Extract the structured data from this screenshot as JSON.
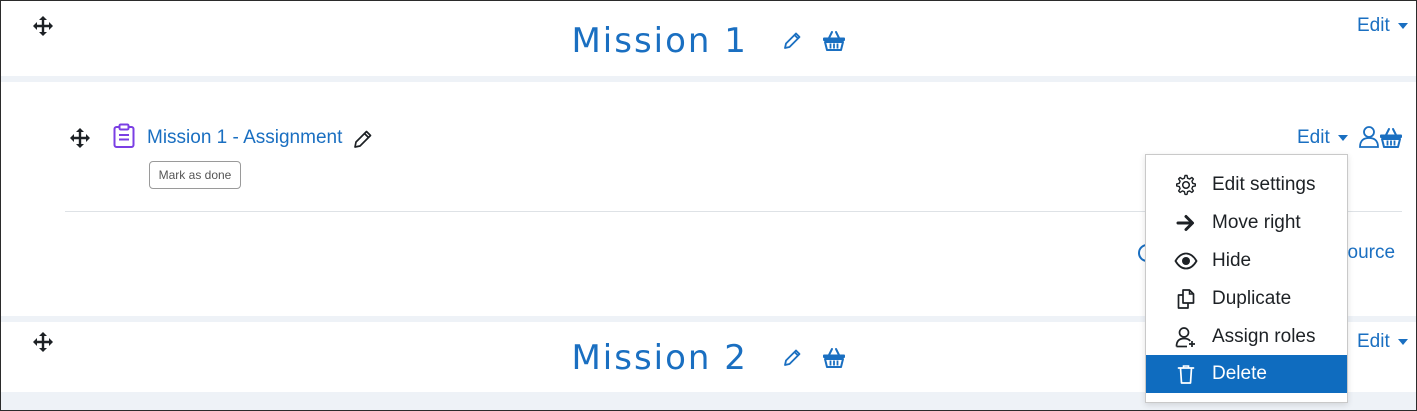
{
  "section1": {
    "title": "Mission 1",
    "edit_label": "Edit"
  },
  "activity": {
    "name": "Mission 1 - Assignment",
    "mark_done_label": "Mark as done",
    "edit_label": "Edit",
    "add_resource_label_visible": "source"
  },
  "menu": {
    "items": [
      {
        "label": "Edit settings",
        "icon": "gear-icon"
      },
      {
        "label": "Move right",
        "icon": "arrow-right-icon"
      },
      {
        "label": "Hide",
        "icon": "eye-icon"
      },
      {
        "label": "Duplicate",
        "icon": "duplicate-icon"
      },
      {
        "label": "Assign roles",
        "icon": "user-plus-icon"
      },
      {
        "label": "Delete",
        "icon": "trash-icon"
      }
    ],
    "active_index": 5
  },
  "section2": {
    "title": "Mission 2",
    "edit_label": "Edit"
  },
  "colors": {
    "link": "#1a6fc1",
    "menu_active": "#0f6cbf",
    "band": "#eef2f7",
    "assign_icon": "#7b3fe4"
  }
}
